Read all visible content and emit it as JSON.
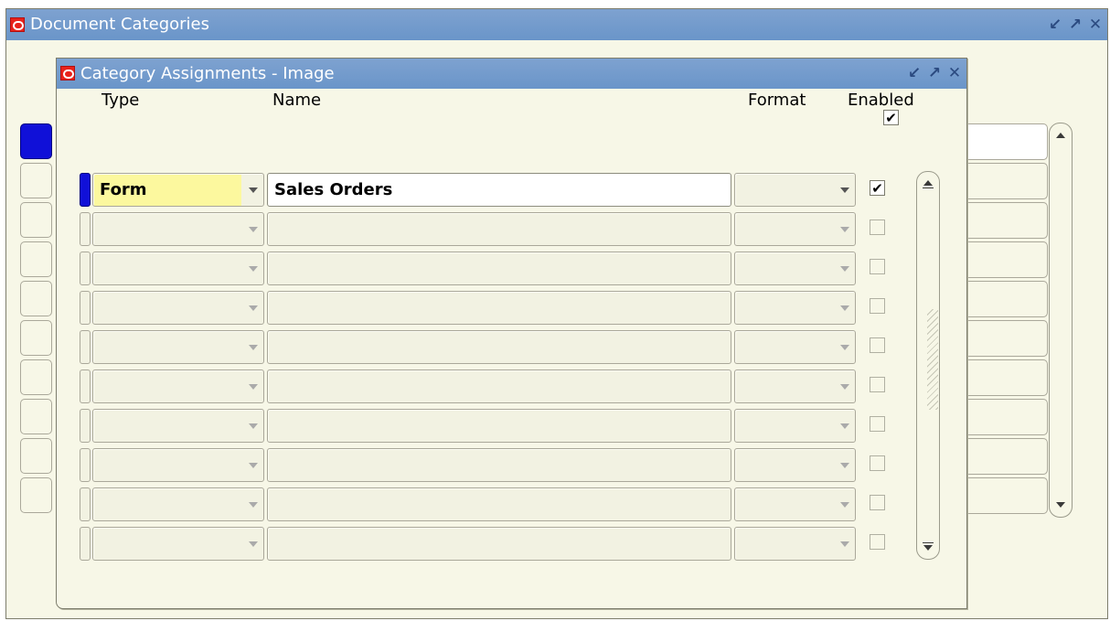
{
  "outer_window": {
    "title": "Document Categories"
  },
  "inner_window": {
    "title": "Category Assignments - Image"
  },
  "titlebar_icons": [
    "minimize-icon",
    "maximize-icon",
    "close-icon"
  ],
  "toolbar": {
    "top_checkbox_checked": true
  },
  "columns": {
    "type": "Type",
    "name": "Name",
    "format": "Format",
    "enabled": "Enabled"
  },
  "rows": [
    {
      "type": "Form",
      "name": "Sales Orders",
      "format": "",
      "enabled": true
    },
    {
      "type": "",
      "name": "",
      "format": "",
      "enabled": false
    },
    {
      "type": "",
      "name": "",
      "format": "",
      "enabled": false
    },
    {
      "type": "",
      "name": "",
      "format": "",
      "enabled": false
    },
    {
      "type": "",
      "name": "",
      "format": "",
      "enabled": false
    },
    {
      "type": "",
      "name": "",
      "format": "",
      "enabled": false
    },
    {
      "type": "",
      "name": "",
      "format": "",
      "enabled": false
    },
    {
      "type": "",
      "name": "",
      "format": "",
      "enabled": false
    },
    {
      "type": "",
      "name": "",
      "format": "",
      "enabled": false
    },
    {
      "type": "",
      "name": "",
      "format": "",
      "enabled": false
    }
  ],
  "colors": {
    "titlebar": "#6a95c9",
    "current_record": "#1010d8",
    "required_field": "#fcf89e",
    "window_bg": "#f7f7e7"
  }
}
